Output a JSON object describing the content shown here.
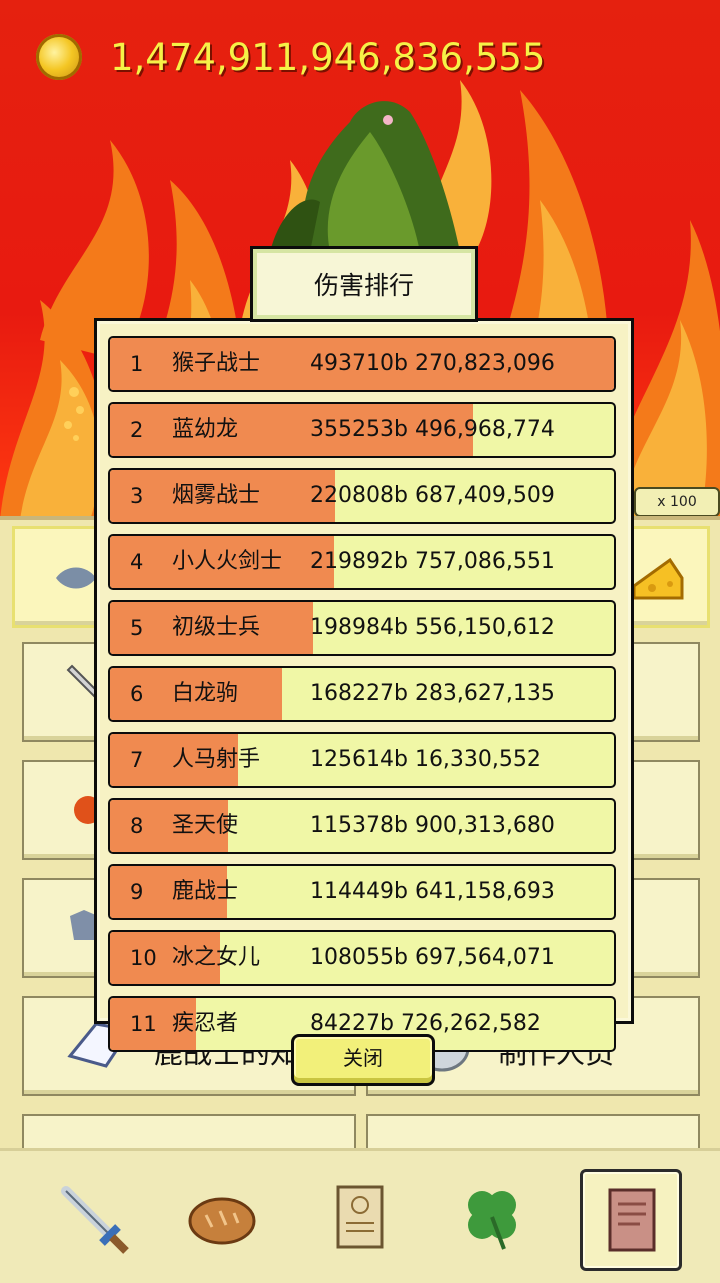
{
  "hud": {
    "coins": "1,474,911,946,836,555",
    "multiplier": "x 100"
  },
  "menu": {
    "knowledge_label": "鹿战士的知识",
    "credits_label": "制作人员"
  },
  "ranking": {
    "title": "伤害排行",
    "close_label": "关闭",
    "rows": [
      {
        "rank": "1",
        "name": "猴子战士",
        "score": "493710b 270,823,096",
        "fill": 1.0
      },
      {
        "rank": "2",
        "name": "蓝幼龙",
        "score": "355253b 496,968,774",
        "fill": 0.72
      },
      {
        "rank": "3",
        "name": "烟雾战士",
        "score": "220808b 687,409,509",
        "fill": 0.447
      },
      {
        "rank": "4",
        "name": "小人火剑士",
        "score": "219892b 757,086,551",
        "fill": 0.445
      },
      {
        "rank": "5",
        "name": "初级士兵",
        "score": "198984b 556,150,612",
        "fill": 0.403
      },
      {
        "rank": "6",
        "name": "白龙驹",
        "score": "168227b 283,627,135",
        "fill": 0.341
      },
      {
        "rank": "7",
        "name": "人马射手",
        "score": "125614b 16,330,552",
        "fill": 0.254
      },
      {
        "rank": "8",
        "name": "圣天使",
        "score": "115378b 900,313,680",
        "fill": 0.234
      },
      {
        "rank": "9",
        "name": "鹿战士",
        "score": "114449b 641,158,693",
        "fill": 0.232
      },
      {
        "rank": "10",
        "name": "冰之女儿",
        "score": "108055b 697,564,071",
        "fill": 0.219
      },
      {
        "rank": "11",
        "name": "疾忍者",
        "score": "84227b 726,262,582",
        "fill": 0.171
      }
    ]
  },
  "nav": {
    "items": [
      {
        "icon": "sword-icon"
      },
      {
        "icon": "bread-icon"
      },
      {
        "icon": "scroll-icon"
      },
      {
        "icon": "clover-icon"
      },
      {
        "icon": "book-icon",
        "active": true
      }
    ]
  },
  "colors": {
    "fire_red": "#e5210f",
    "coin_text": "#f6f247",
    "bar_fill": "#f08a50",
    "bar_track": "#f0f7a6",
    "panel": "#f7f2c4"
  }
}
